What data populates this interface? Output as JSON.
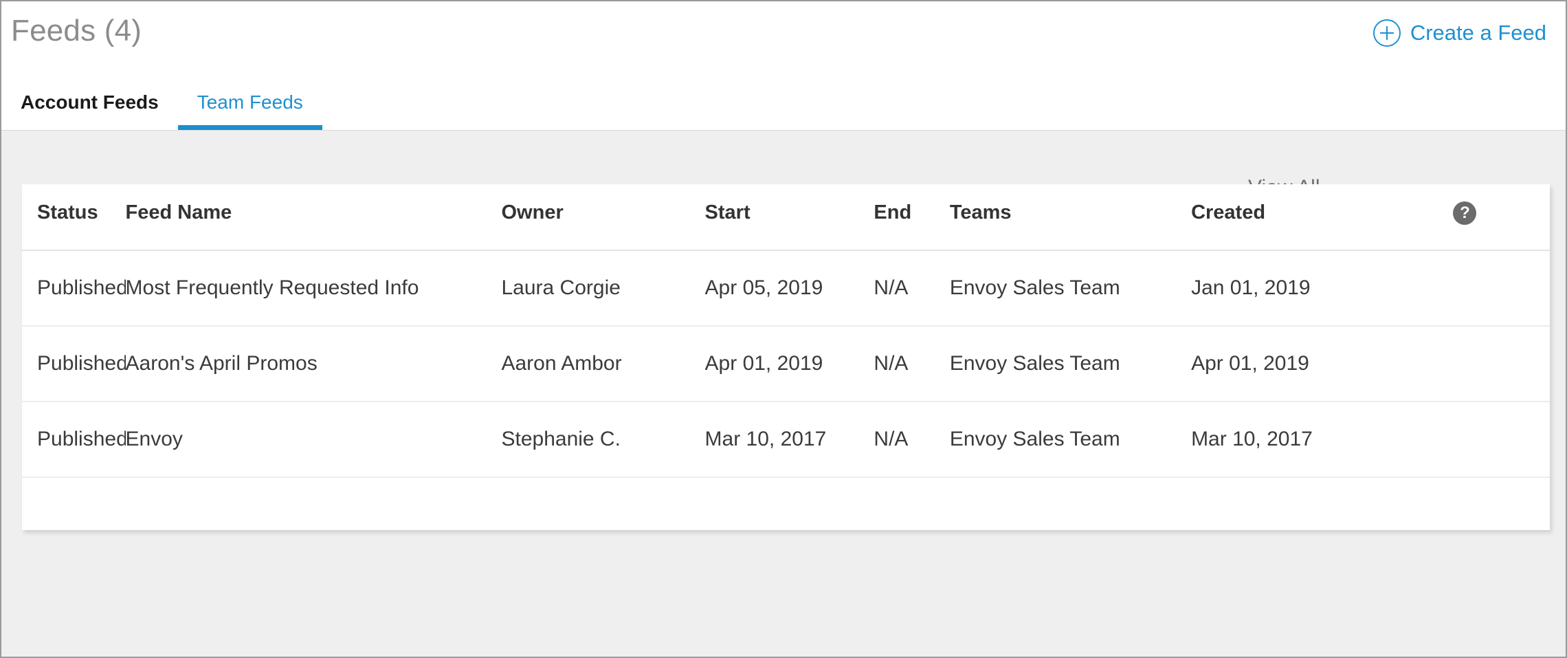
{
  "header": {
    "title": "Feeds (4)",
    "create_feed_label": "Create a Feed",
    "plus_icon": "plus-circle-icon"
  },
  "tabs": [
    {
      "label": "Account Feeds",
      "active": false
    },
    {
      "label": "Team Feeds",
      "active": true
    }
  ],
  "filter": {
    "view_selected": "View All",
    "chevron_icon": "chevron-down-icon"
  },
  "table": {
    "help_icon": "help-circle-icon",
    "help_glyph": "?",
    "columns": [
      "Status",
      "Feed Name",
      "Owner",
      "Start",
      "End",
      "Teams",
      "Created"
    ],
    "rows": [
      {
        "status": "Published",
        "status_color": "#f2a03d",
        "feed_name": "Most Frequently Requested Info",
        "owner": "Laura Corgie",
        "start": "Apr 05, 2019",
        "end": "N/A",
        "teams": "Envoy Sales Team",
        "created": "Jan 01, 2019"
      },
      {
        "status": "Published",
        "status_color": "#55bb5e",
        "feed_name": "Aaron's April Promos",
        "owner": "Aaron Ambor",
        "start": "Apr 01, 2019",
        "end": "N/A",
        "teams": "Envoy Sales Team",
        "created": "Apr 01, 2019"
      },
      {
        "status": "Published",
        "status_color": "#55bb5e",
        "feed_name": "Envoy",
        "owner": "Stephanie C.",
        "start": "Mar 10, 2017",
        "end": "N/A",
        "teams": "Envoy Sales Team",
        "created": "Mar 10, 2017"
      }
    ]
  },
  "colors": {
    "accent_blue": "#1e90d2",
    "status_orange": "#f2a03d",
    "status_green": "#55bb5e",
    "page_background": "#efefef"
  }
}
